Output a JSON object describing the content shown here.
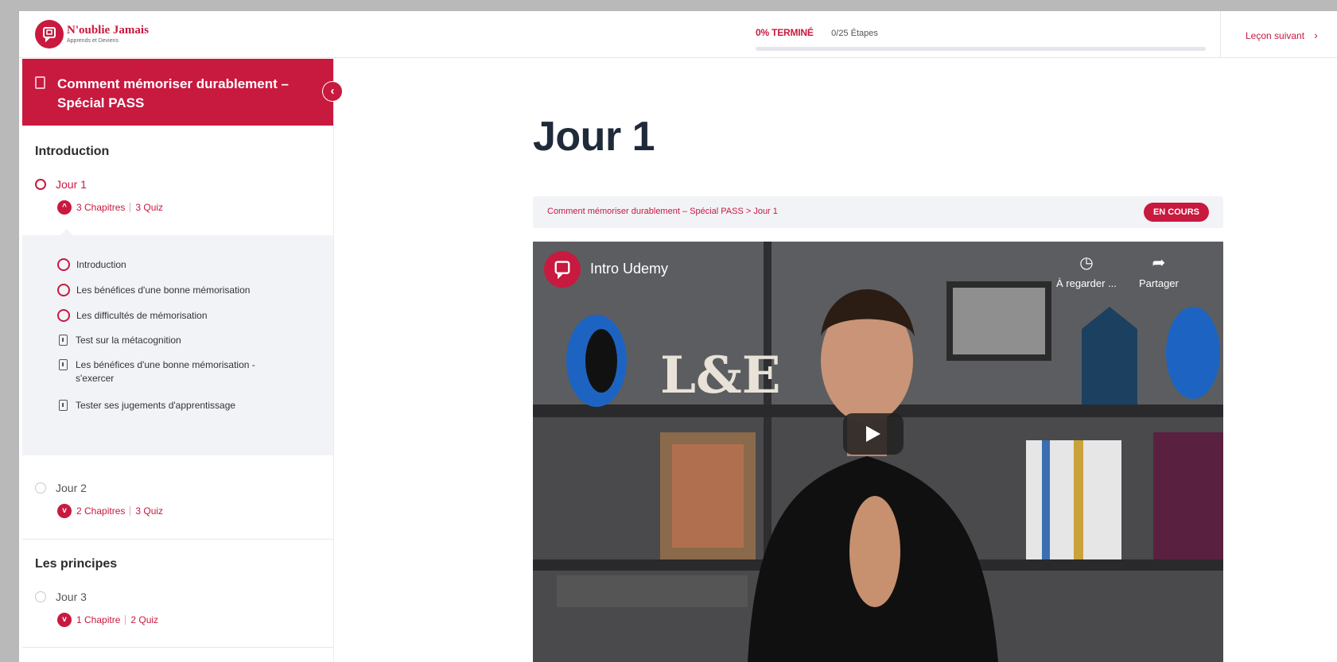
{
  "header": {
    "logo_name": "N'oublie Jamais",
    "logo_tagline": "Apprends et Deviens",
    "progress_label": "0% TERMINÉ",
    "progress_steps": "0/25 Étapes",
    "progress_fraction": 0,
    "next_lesson": "Leçon suivant"
  },
  "sidebar": {
    "course_title": "Comment mémoriser durablement – Spécial PASS",
    "sections": [
      {
        "title": "Introduction",
        "lessons": [
          {
            "label": "Jour 1",
            "chapters": "3 Chapitres",
            "quiz": "3 Quiz",
            "topics": [
              {
                "label": "Introduction",
                "kind": "lesson"
              },
              {
                "label": "Les bénéfices d'une bonne mémorisation",
                "kind": "lesson"
              },
              {
                "label": "Les difficultés de mémorisation",
                "kind": "lesson"
              },
              {
                "label": "Test sur la métacognition",
                "kind": "quiz"
              },
              {
                "label": "Les bénéfices d'une bonne mémorisation - s'exercer",
                "kind": "quiz"
              },
              {
                "label": "Tester ses jugements d'apprentissage",
                "kind": "quiz"
              }
            ]
          },
          {
            "label": "Jour 2",
            "chapters": "2 Chapitres",
            "quiz": "3 Quiz"
          }
        ]
      },
      {
        "title": "Les principes",
        "lessons": [
          {
            "label": "Jour 3",
            "chapters": "1 Chapitre",
            "quiz": "2 Quiz"
          }
        ]
      }
    ]
  },
  "main": {
    "lesson_title": "Jour 1",
    "breadcrumb": "Comment mémoriser durablement – Spécial PASS > Jour 1",
    "status": "EN COURS",
    "video": {
      "title": "Intro Udemy",
      "watch_later": "À regarder ...",
      "share": "Partager"
    }
  },
  "colors": {
    "accent": "#c8193f",
    "heading": "#1f2a3a",
    "panel": "#f2f3f7"
  }
}
